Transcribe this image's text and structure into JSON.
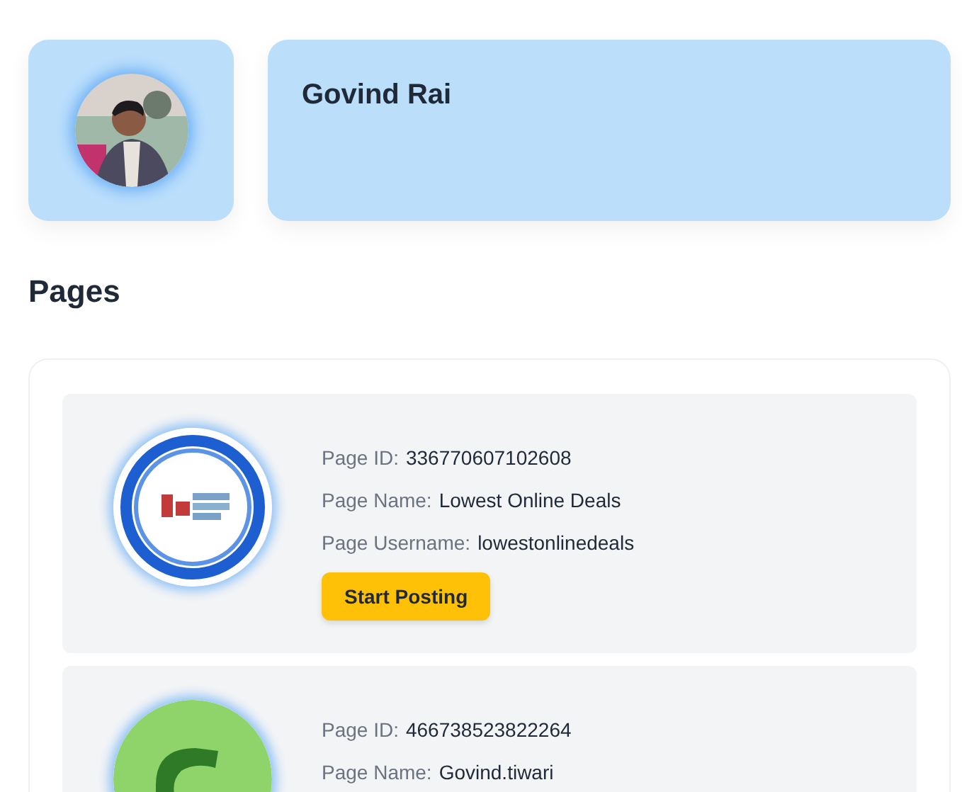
{
  "profile": {
    "name": "Govind Rai"
  },
  "section_title": "Pages",
  "pages": [
    {
      "logo": {
        "kind": "ring"
      },
      "fields": [
        {
          "label": "Page ID:",
          "value": "336770607102608"
        },
        {
          "label": "Page Name:",
          "value": "Lowest Online Deals"
        },
        {
          "label": "Page Username:",
          "value": "lowestonlinedeals"
        }
      ],
      "button": "Start Posting"
    },
    {
      "logo": {
        "kind": "disc"
      },
      "fields": [
        {
          "label": "Page ID:",
          "value": "466738523822264"
        },
        {
          "label": "Page Name:",
          "value": "Govind.tiwari"
        }
      ]
    }
  ]
}
